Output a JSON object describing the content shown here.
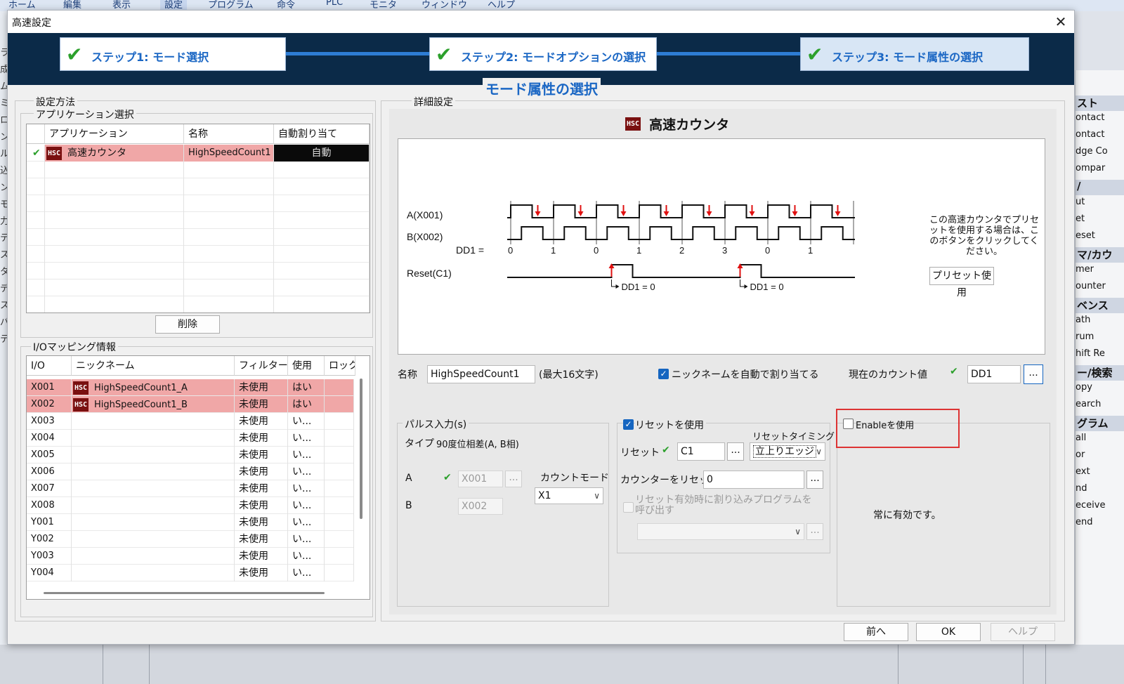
{
  "bg": {
    "menu": [
      "ホーム",
      "編集",
      "表示",
      "設定",
      "プログラム",
      "命令",
      "PLC",
      "モニタ",
      "ウィンドウ",
      "ヘルプ"
    ],
    "left_chars": [
      "ラ",
      "成",
      "ム",
      "ミ",
      "ロ",
      "ン",
      "ル",
      "込",
      "ン",
      "モ",
      "力",
      "テ",
      "ス",
      "タ",
      "デ",
      "ス",
      "バ",
      "テ"
    ],
    "right_items": [
      {
        "t": "スト",
        "h": true
      },
      {
        "t": "ontact",
        "h": false
      },
      {
        "t": "ontact",
        "h": false
      },
      {
        "t": "dge Co",
        "h": false
      },
      {
        "t": "ompar",
        "h": false
      },
      {
        "t": "/",
        "h": true
      },
      {
        "t": "ut",
        "h": false
      },
      {
        "t": "et",
        "h": false
      },
      {
        "t": "eset",
        "h": false
      },
      {
        "t": "マ/カウ",
        "h": true
      },
      {
        "t": "mer",
        "h": false
      },
      {
        "t": "ounter",
        "h": false
      },
      {
        "t": "ベンス",
        "h": true
      },
      {
        "t": "ath",
        "h": false
      },
      {
        "t": "rum",
        "h": false
      },
      {
        "t": "hift Re",
        "h": false
      },
      {
        "t": "ー/検索",
        "h": true
      },
      {
        "t": "opy",
        "h": false
      },
      {
        "t": "earch",
        "h": false
      },
      {
        "t": "グラム",
        "h": true
      },
      {
        "t": "all",
        "h": false
      },
      {
        "t": "or",
        "h": false
      },
      {
        "t": "ext",
        "h": false
      },
      {
        "t": "nd",
        "h": false
      },
      {
        "t": "eceive",
        "h": false
      },
      {
        "t": "end",
        "h": false
      }
    ]
  },
  "dialog": {
    "title": "高速設定",
    "close": "✕",
    "steps": [
      {
        "label": "ステップ1:  モード選択"
      },
      {
        "label": "ステップ2:  モードオプションの選択"
      },
      {
        "label": "ステップ3:  モード属性の選択"
      }
    ],
    "heading": "モード属性の選択"
  },
  "left": {
    "method_title": "設定方法",
    "app_group_title": "アプリケーション選択",
    "app_table": {
      "headers": [
        "アプリケーション",
        "名称",
        "自動割り当て"
      ],
      "rows": [
        {
          "check": "✔",
          "icon": "HSC",
          "app": "高速カウンタ",
          "name": "HighSpeedCount1",
          "auto": "自動"
        }
      ]
    },
    "delete_button": "削除",
    "io_group_title": "I/Oマッピング情報",
    "io_table": {
      "headers": [
        "I/O",
        "ニックネーム",
        "フィルター",
        "使用",
        "ロック"
      ],
      "rows": [
        {
          "io": "X001",
          "icon": "HSC",
          "nick": "HighSpeedCount1_A",
          "filter": "未使用",
          "use": "はい",
          "hl": true
        },
        {
          "io": "X002",
          "icon": "HSC",
          "nick": "HighSpeedCount1_B",
          "filter": "未使用",
          "use": "はい",
          "hl": true
        },
        {
          "io": "X003",
          "icon": "",
          "nick": "",
          "filter": "未使用",
          "use": "い...",
          "hl": false
        },
        {
          "io": "X004",
          "icon": "",
          "nick": "",
          "filter": "未使用",
          "use": "い...",
          "hl": false
        },
        {
          "io": "X005",
          "icon": "",
          "nick": "",
          "filter": "未使用",
          "use": "い...",
          "hl": false
        },
        {
          "io": "X006",
          "icon": "",
          "nick": "",
          "filter": "未使用",
          "use": "い...",
          "hl": false
        },
        {
          "io": "X007",
          "icon": "",
          "nick": "",
          "filter": "未使用",
          "use": "い...",
          "hl": false
        },
        {
          "io": "X008",
          "icon": "",
          "nick": "",
          "filter": "未使用",
          "use": "い...",
          "hl": false
        },
        {
          "io": "Y001",
          "icon": "",
          "nick": "",
          "filter": "未使用",
          "use": "い...",
          "hl": false
        },
        {
          "io": "Y002",
          "icon": "",
          "nick": "",
          "filter": "未使用",
          "use": "い...",
          "hl": false
        },
        {
          "io": "Y003",
          "icon": "",
          "nick": "",
          "filter": "未使用",
          "use": "い...",
          "hl": false
        },
        {
          "io": "Y004",
          "icon": "",
          "nick": "",
          "filter": "未使用",
          "use": "い...",
          "hl": false
        }
      ]
    }
  },
  "detail": {
    "title": "詳細設定",
    "hsc_icon": "HSC",
    "hsc_title": "高速カウンタ",
    "diagram": {
      "a_label": "A(X001)",
      "b_label": "B(X002)",
      "dd1_label": "DD1 =",
      "counts": [
        "0",
        "1",
        "0",
        "1",
        "2",
        "3",
        "0",
        "1"
      ],
      "reset_label": "Reset(C1)",
      "reset_note": "DD1 = 0"
    },
    "preset_note": "この高速カウンタでプリセットを使用する場合は、このボタンをクリックしてください。",
    "preset_button": "プリセット使用",
    "name_label": "名称",
    "name_value": "HighSpeedCount1",
    "name_hint": "(最大16文字)",
    "auto_nick_label": "ニックネームを自動で割り当てる",
    "current_label": "現在のカウント値",
    "current_value": "DD1",
    "browse": "...",
    "pulse": {
      "title": "パルス入力(s)",
      "type_label": "タイプ",
      "type_value": "90度位相差(A, B相)",
      "a_label": "A",
      "a_value": "X001",
      "b_label": "B",
      "b_value": "X002",
      "count_mode_label": "カウントモード",
      "count_mode_value": "X1"
    },
    "reset": {
      "use_label": "リセットを使用",
      "timing_label": "リセットタイミング",
      "reset_label": "リセット",
      "reset_value": "C1",
      "timing_value": "立上りエッジ",
      "counter_reset_label": "カウンターをリセット",
      "counter_reset_value": "0",
      "interrupt_label": "リセット有効時に割り込みプログラムを呼び出す"
    },
    "enable": {
      "use_label": "Enableを使用",
      "always_label": "常に有効です。"
    }
  },
  "footer": {
    "back": "前へ",
    "ok": "OK",
    "help": "ヘルプ"
  }
}
